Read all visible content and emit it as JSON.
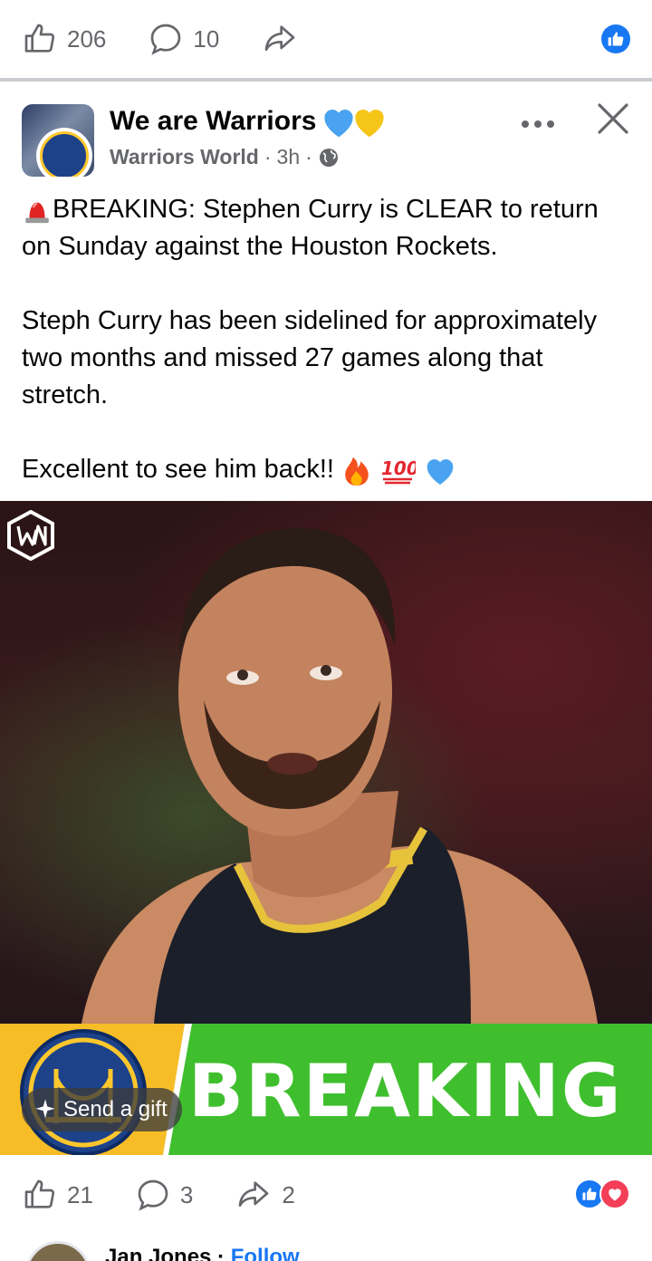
{
  "prev_post_actions": {
    "like_count": "206",
    "comment_count": "10"
  },
  "post": {
    "group_name": "We are Warriors",
    "author": "Warriors World",
    "time": "3h",
    "body": {
      "line1": "BREAKING: Stephen Curry is CLEAR to return on Sunday against the Houston Rockets.",
      "line2": "Steph Curry has been sidelined for approximately two months and missed 27 games along that stretch.",
      "line3": "Excellent to see him back!!"
    },
    "image": {
      "banner_text": "BREAKING",
      "send_gift_label": "Send a gift"
    },
    "actions": {
      "like_count": "21",
      "comment_count": "3",
      "share_count": "2"
    }
  },
  "comment_preview": {
    "name": "Jan Jones",
    "separator": "·",
    "follow_label": "Follow"
  },
  "colors": {
    "facebook_blue": "#1877f2",
    "love_red": "#f33e58",
    "secondary_text": "#65676b",
    "banner_green": "#3fbf2e",
    "banner_yellow": "#f6bd27"
  }
}
